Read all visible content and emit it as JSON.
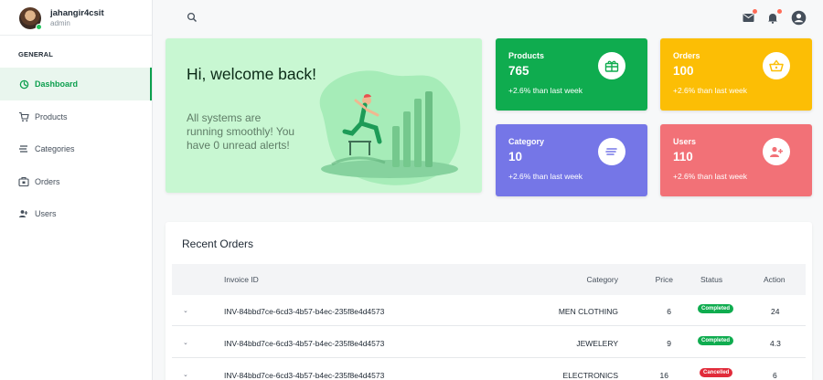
{
  "user": {
    "name": "jahangir4csit",
    "role": "admin"
  },
  "sidebar": {
    "heading": "GENERAL",
    "items": [
      {
        "label": "Dashboard",
        "icon": "dashboard-icon",
        "active": true
      },
      {
        "label": "Products",
        "icon": "cart-icon",
        "active": false
      },
      {
        "label": "Categories",
        "icon": "categories-icon",
        "active": false
      },
      {
        "label": "Orders",
        "icon": "orders-icon",
        "active": false
      },
      {
        "label": "Users",
        "icon": "users-icon",
        "active": false
      }
    ]
  },
  "topbar": {
    "icons": [
      "search-icon",
      "mail-icon",
      "bell-icon",
      "account-icon"
    ]
  },
  "welcome": {
    "title": "Hi, welcome back!",
    "text": "All systems are running smoothly! You have 0 unread alerts!"
  },
  "stats": [
    {
      "title": "Products",
      "value": "765",
      "trend": "+2.6% than last week",
      "color": "#0fac4f",
      "icon": "gift-icon"
    },
    {
      "title": "Orders",
      "value": "100",
      "trend": "+2.6% than last week",
      "color": "#fcbe05",
      "icon": "basket-icon"
    },
    {
      "title": "Category",
      "value": "10",
      "trend": "+2.6% than last week",
      "color": "#7576e7",
      "icon": "list-icon"
    },
    {
      "title": "Users",
      "value": "110",
      "trend": "+2.6% than last week",
      "color": "#f27177",
      "icon": "user-add-icon"
    }
  ],
  "orders": {
    "title": "Recent Orders",
    "columns": [
      "Invoice ID",
      "Category",
      "Price",
      "Status",
      "Action"
    ],
    "rows": [
      {
        "invoice": "INV-84bbd7ce-6cd3-4b57-b4ec-235f8e4d4573",
        "category": "MEN CLOTHING",
        "price": "6",
        "status": "Completed",
        "action": "24"
      },
      {
        "invoice": "INV-84bbd7ce-6cd3-4b57-b4ec-235f8e4d4573",
        "category": "JEWELERY",
        "price": "9",
        "status": "Completed",
        "action": "4.3"
      },
      {
        "invoice": "INV-84bbd7ce-6cd3-4b57-b4ec-235f8e4d4573",
        "category": "ELECTRONICS",
        "price": "16",
        "status": "Cancelled",
        "action": "6"
      }
    ],
    "status_colors": {
      "Completed": "#0fac4f",
      "Cancelled": "#e12b3a"
    }
  },
  "colors": {
    "accent": "#0c9f4e",
    "welcome_bg": "#c8f7d2"
  }
}
